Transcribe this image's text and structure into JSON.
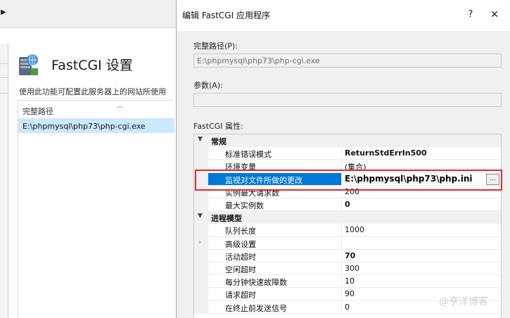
{
  "background": {
    "title": "FastCGI 设置",
    "description": "使用此功能可配置此服务器上的网站所使用",
    "list": {
      "column_header": "完整路径",
      "rows": [
        "E:\\phpmysql\\php73\\php-cgi.exe"
      ]
    }
  },
  "dialog": {
    "title": "编辑 FastCGI 应用程序",
    "help_label": "?",
    "close_label": "✕",
    "full_path_label": "完整路径(P):",
    "full_path_value": "E:\\phpmysql\\php73\\php-cgi.exe",
    "arguments_label": "参数(A):",
    "arguments_value": "",
    "properties_label": "FastCGI 属性:",
    "browse_label": "...",
    "grid": {
      "general": {
        "label": "常规",
        "rows": [
          {
            "name": "标准错误模式",
            "value": "ReturnStdErrIn500"
          },
          {
            "name": "环境变量",
            "value": "(集合)"
          },
          {
            "name": "监视对文件所做的更改",
            "value": "E:\\phpmysql\\php73\\php.ini"
          },
          {
            "name": "实例最大请求数",
            "value": "200"
          },
          {
            "name": "最大实例数",
            "value": "0"
          }
        ]
      },
      "process_model": {
        "label": "进程模型",
        "rows": [
          {
            "name": "队列长度",
            "value": "1000"
          },
          {
            "name": "高级设置",
            "value": ""
          },
          {
            "name": "活动超时",
            "value": "70"
          },
          {
            "name": "空闲超时",
            "value": "300"
          },
          {
            "name": "每分钟快速故障数",
            "value": "10"
          },
          {
            "name": "请求超时",
            "value": "90"
          },
          {
            "name": "在终止前发送信号",
            "value": "0"
          }
        ]
      }
    }
  },
  "watermark": "@亨洋博客",
  "colors": {
    "selection": "#0078d7",
    "highlight_box": "#e8262a",
    "list_selection": "#cce8ff"
  }
}
